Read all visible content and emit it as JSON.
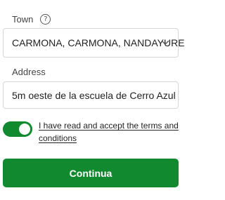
{
  "town": {
    "label": "Town",
    "help_icon": "question-circle-icon",
    "help_glyph": "?",
    "selected_value": "CARMONA, CARMONA, NANDAYURE",
    "dropdown_icon": "chevron-down-icon"
  },
  "address": {
    "label": "Address",
    "value": "5m oeste de la escuela de Cerro Azul"
  },
  "terms": {
    "toggle_on": true,
    "text": "I have read and accept the terms and conditions"
  },
  "actions": {
    "continue_label": "Continua"
  },
  "colors": {
    "accent": "#118a2f",
    "border": "#d7d7d7"
  }
}
